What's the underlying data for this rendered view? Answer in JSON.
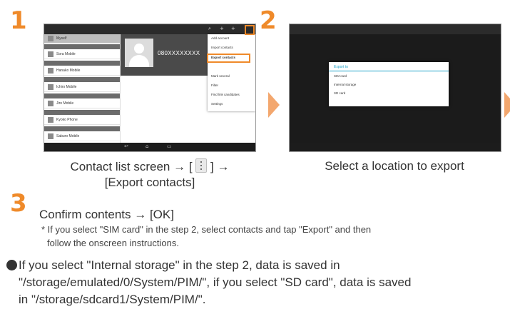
{
  "steps": {
    "one": "1",
    "two": "2",
    "three": "3"
  },
  "screen1": {
    "phone_number": "080XXXXXXXX",
    "menu_items": [
      "Add account",
      "Import contacts",
      "Export contacts",
      "Mark several",
      "Filter",
      "Find link candidates",
      "Settings",
      "Send contact"
    ],
    "highlighted_item": "Export contacts",
    "contacts": [
      "Myself",
      "Sora Mobile",
      "Hanako Mobile",
      "Ichiro Mobile",
      "Jiro Mobile",
      "Kyoko Phone",
      "Saburo Mobile"
    ]
  },
  "screen2": {
    "dialog_title": "Export to",
    "options": [
      "SIM card",
      "Internal storage",
      "SD card"
    ]
  },
  "captions": {
    "step1_line1_a": "Contact list screen → [",
    "step1_line1_b": "] →",
    "step1_line2": "[Export contacts]",
    "step2": "Select a location to export",
    "step3": "Confirm contents → [OK]"
  },
  "notes": {
    "star_line1": "* If you select \"SIM card\" in the step 2, select contacts and tap \"Export\" and then",
    "star_line2": "follow the onscreen instructions.",
    "bullet_line1": "If you select \"Internal storage\" in the step 2, data is saved in",
    "bullet_line2": "\"/storage/emulated/0/System/PIM/\", if you select \"SD card\", data is saved",
    "bullet_line3": "in \"/storage/sdcard1/System/PIM/\"."
  },
  "colors": {
    "accent_orange": "#ef8a2a",
    "arrow_orange": "#f3a76e",
    "dialog_blue": "#1ba1c9"
  },
  "icons": [
    "menu-dots-icon",
    "right-arrow-icon",
    "bullet-icon"
  ]
}
